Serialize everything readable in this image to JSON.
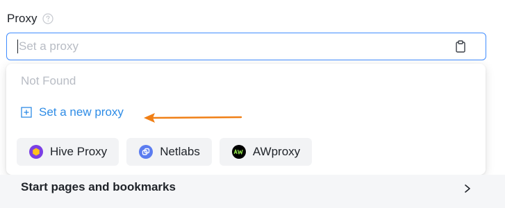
{
  "proxy_section": {
    "label": "Proxy",
    "input": {
      "value": "",
      "placeholder": "Set a proxy"
    },
    "icons": {
      "help": "question-circle-icon",
      "clipboard": "clipboard-icon"
    }
  },
  "dropdown": {
    "not_found": "Not Found",
    "new_proxy_label": "Set a new proxy",
    "new_proxy_icon": "plus-square-icon",
    "annotation_arrow_color": "#f07f15",
    "chips": [
      {
        "label": "Hive Proxy",
        "icon": "hive-proxy-icon",
        "color": "#7b3fe4"
      },
      {
        "label": "Netlabs",
        "icon": "netlabs-icon",
        "color": "#5b7cf0"
      },
      {
        "label": "AWproxy",
        "icon": "awproxy-icon",
        "color": "#000000"
      }
    ]
  },
  "next_section": {
    "label": "Start pages and bookmarks",
    "icon": "chevron-right-icon"
  },
  "colors": {
    "accent": "#2e8ce6",
    "input_border": "#3f8cff",
    "placeholder": "#b8bcc4",
    "chip_bg": "#f2f3f5"
  }
}
